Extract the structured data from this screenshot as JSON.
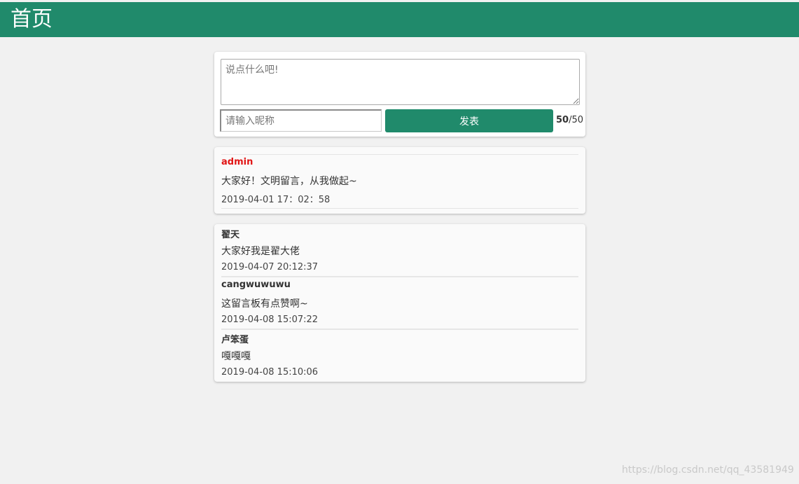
{
  "header": {
    "title": "首页"
  },
  "compose": {
    "message_placeholder": "说点什么吧!",
    "nickname_placeholder": "请输入昵称",
    "publish_label": "发表",
    "counter_current": "50",
    "counter_max": "/50"
  },
  "featured": {
    "name": "admin",
    "text": "大家好！文明留言，从我做起~",
    "time": "2019-04-01 17：02：58"
  },
  "messages": [
    {
      "name": "翟天",
      "text": "大家好我是翟大佬",
      "time": "2019-04-07 20:12:37"
    },
    {
      "name": "cangwuwuwu",
      "text": "这留言板有点赞啊~",
      "time": "2019-04-08 15:07:22"
    },
    {
      "name": "卢笨蛋",
      "text": "嘎嘎嘎",
      "time": "2019-04-08 15:10:06"
    }
  ],
  "watermark": "https://blog.csdn.net/qq_43581949",
  "colors": {
    "primary": "#208a6b",
    "admin_name": "#e11515",
    "background": "#f1f1f1"
  }
}
